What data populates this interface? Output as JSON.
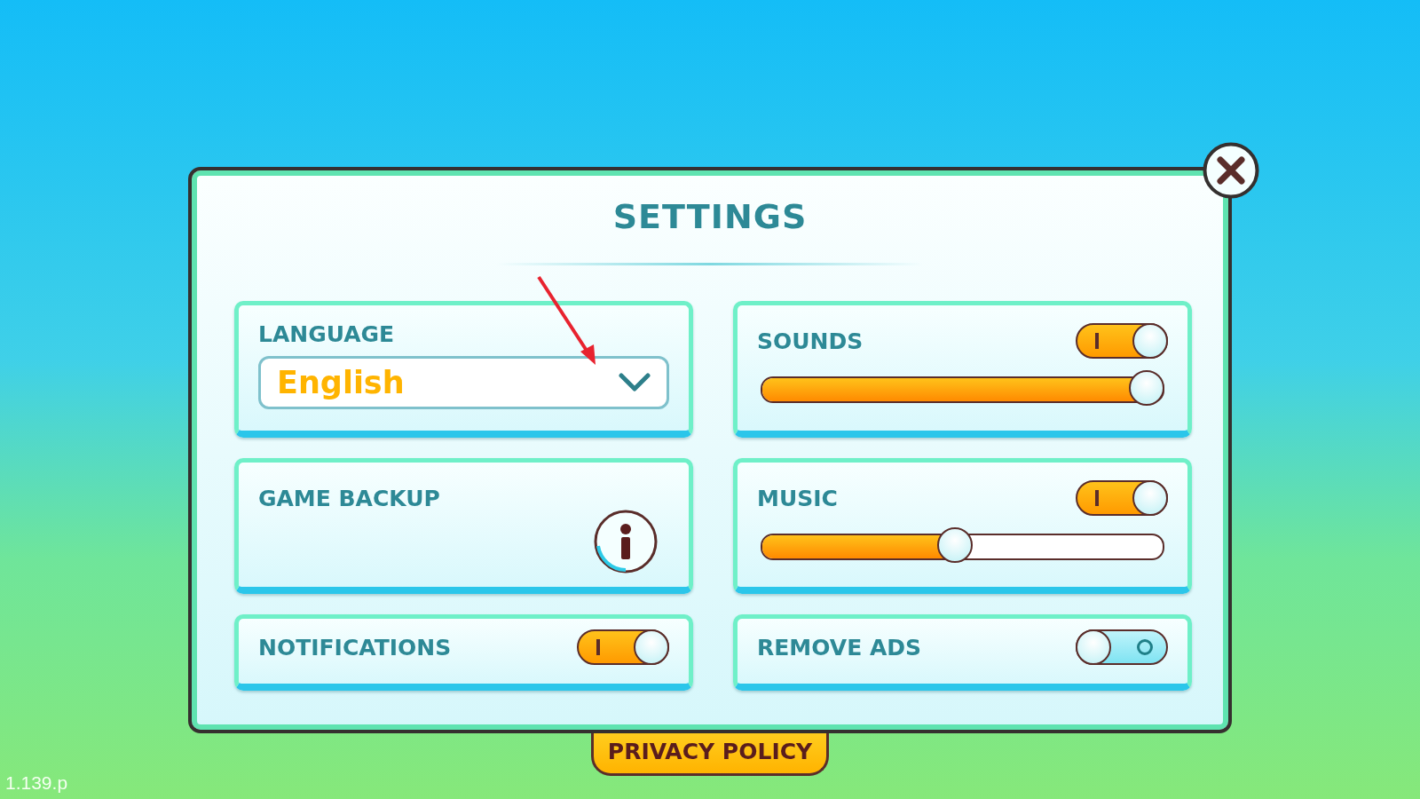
{
  "title": "SETTINGS",
  "cards": [
    {
      "kind": "dropdown",
      "label": "LANGUAGE",
      "value": "English"
    },
    {
      "kind": "slider",
      "label": "SOUNDS",
      "on": true,
      "level": 1.0
    },
    {
      "kind": "info",
      "label": "GAME BACKUP"
    },
    {
      "kind": "slider",
      "label": "MUSIC",
      "on": true,
      "level": 0.5
    },
    {
      "kind": "toggle",
      "label": "NOTIFICATIONS",
      "on": true
    },
    {
      "kind": "toggle",
      "label": "REMOVE ADS",
      "on": false
    }
  ],
  "privacy_policy": "PRIVACY POLICY",
  "version": "1.139.p"
}
